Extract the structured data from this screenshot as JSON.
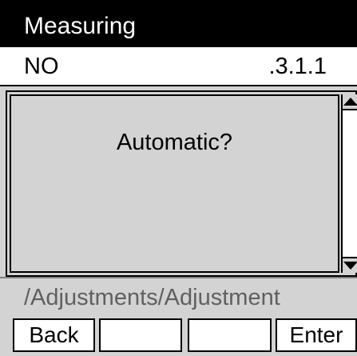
{
  "title": "Measuring",
  "info": {
    "left": "NO",
    "right": ".3.1.1"
  },
  "dialog": {
    "prompt": "Automatic?"
  },
  "path": "/Adjustments/Adjustment",
  "softkeys": [
    "Back",
    "",
    "",
    "Enter"
  ],
  "icons": {
    "scroll_up": "triangle-up-icon",
    "scroll_down": "triangle-down-icon"
  },
  "colors": {
    "title_bg": "#000000",
    "panel_bg": "#d3d3d3",
    "info_bg": "#ffffff",
    "path_text": "#606060"
  }
}
